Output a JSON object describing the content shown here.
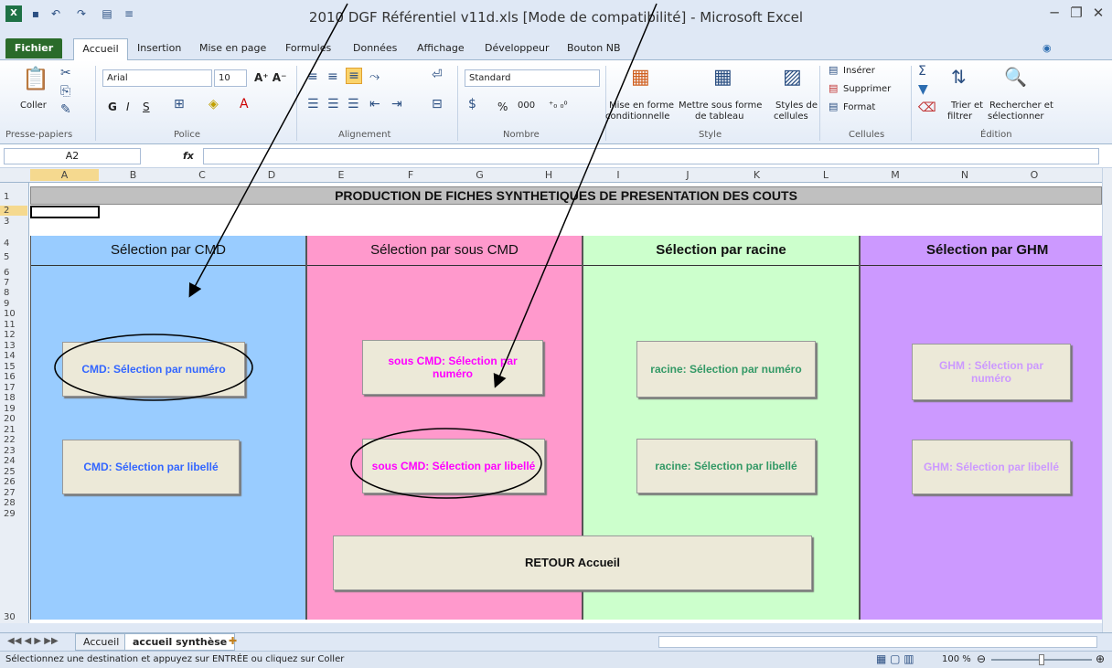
{
  "window": {
    "title": "2010 DGF Référentiel v11d.xls  [Mode de compatibilité]  -  Microsoft Excel"
  },
  "tabs": [
    "Fichier",
    "Accueil",
    "Insertion",
    "Mise en page",
    "Formules",
    "Données",
    "Affichage",
    "Développeur",
    "Bouton NB"
  ],
  "ribbon": {
    "clipboard": {
      "paste": "Coller",
      "label": "Presse-papiers"
    },
    "font": {
      "name": "Arial",
      "size": "10",
      "label": "Police"
    },
    "alignment": {
      "label": "Alignement"
    },
    "number": {
      "format": "Standard",
      "percent": "%",
      "thousands": "000",
      "label": "Nombre"
    },
    "style": {
      "cond1": "Mise en forme",
      "cond2": "conditionnelle",
      "table1": "Mettre sous forme",
      "table2": "de tableau",
      "cell1": "Styles de",
      "cell2": "cellules",
      "label": "Style"
    },
    "cells": {
      "insert": "Insérer",
      "delete": "Supprimer",
      "format": "Format",
      "label": "Cellules"
    },
    "editing": {
      "sort1": "Trier et",
      "sort2": "filtrer",
      "find1": "Rechercher et",
      "find2": "sélectionner",
      "label": "Édition"
    }
  },
  "formula_bar": {
    "name_box": "A2",
    "fx": "fx",
    "value": ""
  },
  "columns": [
    "A",
    "B",
    "C",
    "D",
    "E",
    "F",
    "G",
    "H",
    "I",
    "J",
    "K",
    "L",
    "M",
    "N",
    "O"
  ],
  "rows": [
    "1",
    "2",
    "3",
    "4",
    "5",
    "6",
    "7",
    "8",
    "9",
    "10",
    "11",
    "12",
    "13",
    "14",
    "15",
    "16",
    "17",
    "18",
    "19",
    "20",
    "21",
    "22",
    "23",
    "24",
    "25",
    "26",
    "27",
    "28",
    "29",
    "30"
  ],
  "banner": "PRODUCTION DE FICHES SYNTHETIQUES DE PRESENTATION DES COUTS",
  "panels": [
    {
      "title": "Sélection par CMD",
      "color": "#99ccff",
      "text_color": "#3366ff",
      "btn1": "CMD: Sélection par numéro",
      "btn2": "CMD: Sélection par libellé"
    },
    {
      "title": "Sélection par  sous CMD",
      "color": "#ff99cc",
      "text_color": "#ff00ff",
      "btn1": "sous CMD: Sélection par numéro",
      "btn2": "sous CMD: Sélection par libellé"
    },
    {
      "title": "Sélection par racine",
      "color": "#ccffcc",
      "text_color": "#339966",
      "btn1": "racine: Sélection par numéro",
      "btn2": "racine: Sélection par libellé"
    },
    {
      "title": "Sélection par GHM",
      "color": "#cc99ff",
      "text_color": "#cc99ff",
      "btn1": "GHM : Sélection par numéro",
      "btn2": "GHM:  Sélection par libellé"
    }
  ],
  "return_button": "RETOUR Accueil",
  "sheet_tabs": [
    "Accueil",
    "accueil synthèse"
  ],
  "status": {
    "message": "Sélectionnez une destination et appuyez sur ENTRÉE ou cliquez sur Coller",
    "zoom": "100 %"
  }
}
